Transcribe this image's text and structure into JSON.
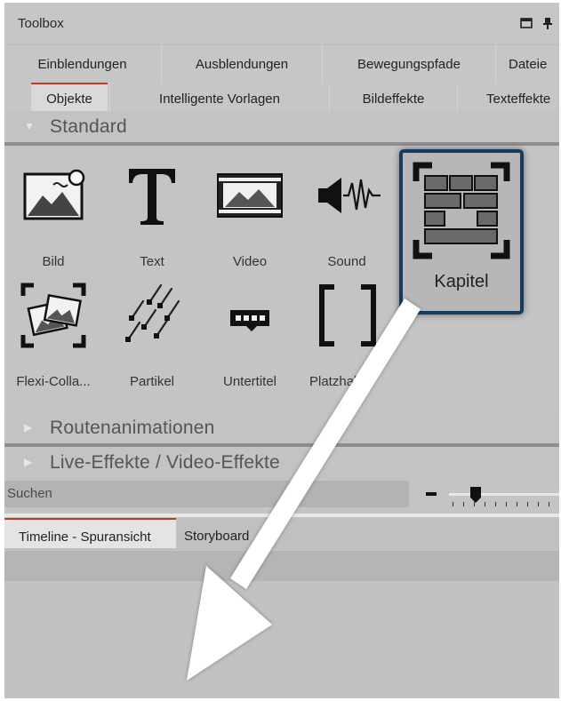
{
  "window": {
    "title": "Toolbox"
  },
  "tabs_row1": [
    {
      "label": "Einblendungen"
    },
    {
      "label": "Ausblendungen"
    },
    {
      "label": "Bewegungspfade"
    },
    {
      "label": "Dateie"
    }
  ],
  "tabs_row2": [
    {
      "label": "Objekte",
      "active": true
    },
    {
      "label": "Intelligente Vorlagen"
    },
    {
      "label": "Bildeffekte"
    },
    {
      "label": "Texteffekte"
    }
  ],
  "sections": {
    "standard": "Standard",
    "routenanimationen": "Routenanimationen",
    "live_effekte": "Live-Effekte / Video-Effekte"
  },
  "objects": [
    {
      "label": "Bild",
      "icon": "image-icon"
    },
    {
      "label": "Text",
      "icon": "text-icon"
    },
    {
      "label": "Video",
      "icon": "video-icon"
    },
    {
      "label": "Sound",
      "icon": "sound-icon"
    },
    {
      "label": "Flexi-Colla...",
      "icon": "flexi-collage-icon"
    },
    {
      "label": "Partikel",
      "icon": "particle-icon"
    },
    {
      "label": "Untertitel",
      "icon": "subtitle-icon"
    },
    {
      "label": "Platzhal",
      "icon": "placeholder-icon"
    }
  ],
  "highlight": {
    "label": "Kapitel",
    "icon": "chapter-icon",
    "border_color": "#153c5e"
  },
  "search": {
    "placeholder": "Suchen"
  },
  "bottom_tabs": [
    {
      "label": "Timeline - Spuransicht",
      "active": true
    },
    {
      "label": "Storyboard"
    }
  ],
  "colors": {
    "accent": "#c0392b",
    "highlight_border": "#153c5e",
    "panel": "#c4c4c4"
  }
}
